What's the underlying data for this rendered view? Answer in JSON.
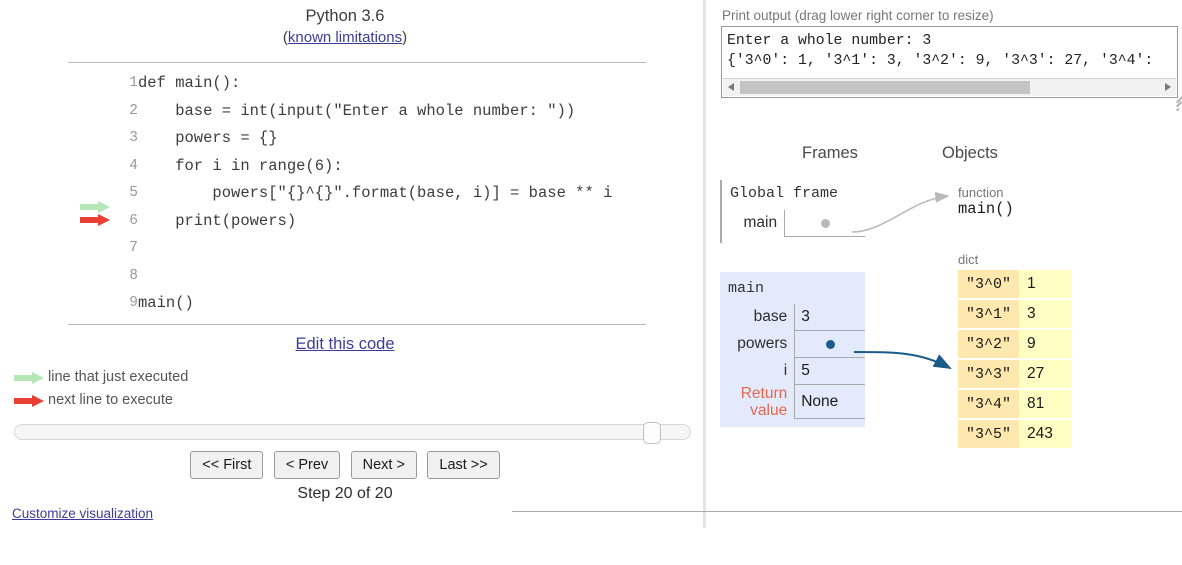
{
  "left": {
    "language": "Python 3.6",
    "limitations_open_paren": "(",
    "limitations_link": "known limitations",
    "limitations_close_paren": ")",
    "code_lines": [
      {
        "number": "1",
        "text": "def main():",
        "marker": ""
      },
      {
        "number": "2",
        "text": "    base = int(input(\"Enter a whole number: \"))",
        "marker": ""
      },
      {
        "number": "3",
        "text": "    powers = {}",
        "marker": ""
      },
      {
        "number": "4",
        "text": "    for i in range(6):",
        "marker": ""
      },
      {
        "number": "5",
        "text": "        powers[\"{}^{}\".format(base, i)] = base ** i",
        "marker": ""
      },
      {
        "number": "6",
        "text": "    print(powers)",
        "marker": "both"
      },
      {
        "number": "7",
        "text": "",
        "marker": ""
      },
      {
        "number": "8",
        "text": "",
        "marker": ""
      },
      {
        "number": "9",
        "text": "main()",
        "marker": ""
      }
    ],
    "edit_code_link": "Edit this code",
    "legend": [
      {
        "type": "green",
        "label": "line that just executed"
      },
      {
        "type": "red",
        "label": "next line to execute"
      }
    ],
    "buttons": {
      "first": "<< First",
      "prev": "< Prev",
      "next": "Next >",
      "last": "Last >>"
    },
    "step_label": "Step 20 of 20",
    "customize_link": "Customize visualization"
  },
  "right": {
    "print_output_label": "Print output (drag lower right corner to resize)",
    "print_output_text": "Enter a whole number: 3\n{'3^0': 1, '3^1': 3, '3^2': 9, '3^3': 27, '3^4':",
    "frames_header": "Frames",
    "objects_header": "Objects",
    "global_frame": {
      "title": "Global frame",
      "vars": [
        {
          "name": "main",
          "value": "",
          "is_pointer": true
        }
      ]
    },
    "main_frame": {
      "title": "main",
      "vars": [
        {
          "name": "base",
          "value": "3",
          "is_pointer": false
        },
        {
          "name": "powers",
          "value": "",
          "is_pointer": true
        },
        {
          "name": "i",
          "value": "5",
          "is_pointer": false
        }
      ],
      "return_label_line1": "Return",
      "return_label_line2": "value",
      "return_value": "None"
    },
    "objects": {
      "function_type_label": "function",
      "function_name": "main()",
      "dict_type_label": "dict",
      "dict_entries": [
        {
          "key": "\"3^0\"",
          "value": "1"
        },
        {
          "key": "\"3^1\"",
          "value": "3"
        },
        {
          "key": "\"3^2\"",
          "value": "9"
        },
        {
          "key": "\"3^3\"",
          "value": "27"
        },
        {
          "key": "\"3^4\"",
          "value": "81"
        },
        {
          "key": "\"3^5\"",
          "value": "243"
        }
      ]
    }
  },
  "colors": {
    "just_executed_arrow": "#b5e6b5",
    "next_line_arrow": "#e93f34",
    "frame_highlight_bg": "#e2eafc",
    "dict_key_bg": "#ffe8ad",
    "dict_value_bg": "#ffffc4",
    "pointer_arrow": "#1a5b8a",
    "function_arrow": "#bbbbbb",
    "link_color": "#3d3d99",
    "return_label_color": "#e8674c"
  }
}
